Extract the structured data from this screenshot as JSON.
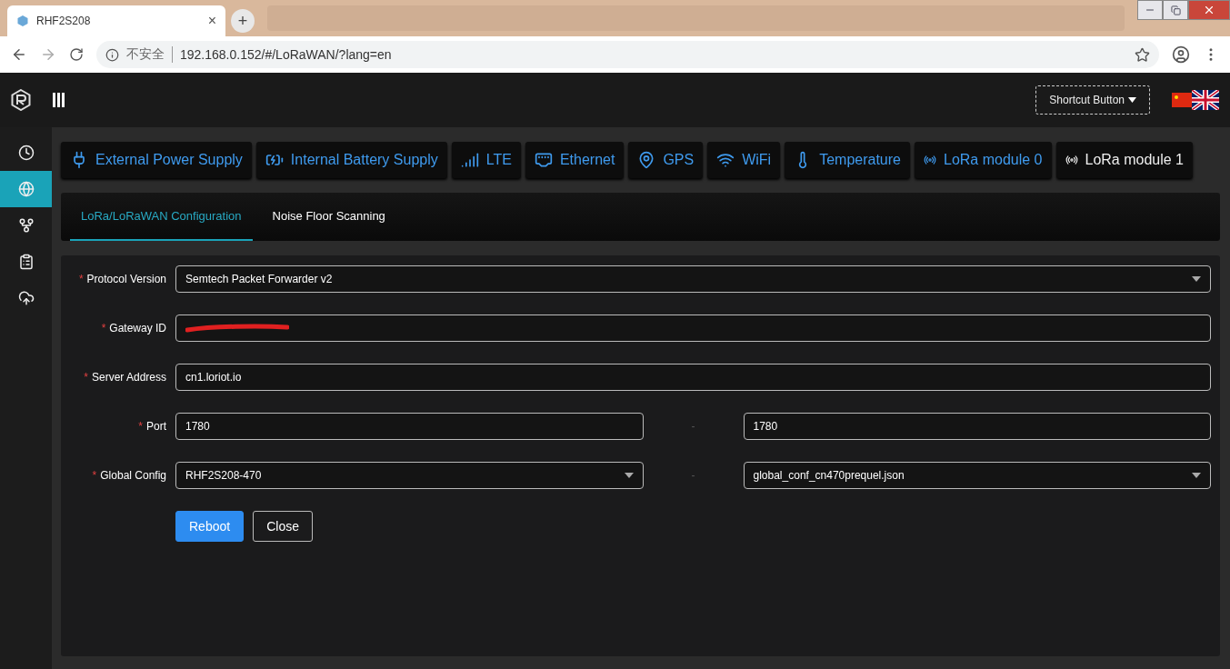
{
  "browser": {
    "tab_title": "RHF2S208",
    "close": "×",
    "new_tab": "+",
    "security": "不安全",
    "url": "192.168.0.152/#/LoRaWAN/?lang=en"
  },
  "header": {
    "shortcut_button": "Shortcut Button"
  },
  "sidebar": {
    "items": [
      {
        "selected": false
      },
      {
        "selected": true
      },
      {
        "selected": false
      },
      {
        "selected": false
      },
      {
        "selected": false
      }
    ]
  },
  "modules": [
    {
      "label": "External Power Supply",
      "selected": false
    },
    {
      "label": "Internal Battery Supply",
      "selected": false
    },
    {
      "label": "LTE",
      "selected": false
    },
    {
      "label": "Ethernet",
      "selected": false
    },
    {
      "label": "GPS",
      "selected": false
    },
    {
      "label": "WiFi",
      "selected": false
    },
    {
      "label": "Temperature",
      "selected": false
    },
    {
      "label": "LoRa module 0",
      "selected": false
    },
    {
      "label": "LoRa module 1",
      "selected": true
    }
  ],
  "tabs": [
    {
      "label": "LoRa/LoRaWAN Configuration",
      "selected": true
    },
    {
      "label": "Noise Floor Scanning",
      "selected": false
    }
  ],
  "form": {
    "rows": [
      {
        "label": "Protocol Version",
        "required_mark": "*",
        "fields": [
          {
            "kind": "select",
            "value": "Semtech Packet Forwarder v2"
          }
        ]
      },
      {
        "label": "Gateway ID",
        "required_mark": "*",
        "fields": [
          {
            "kind": "redacted"
          }
        ]
      },
      {
        "label": "Server Address",
        "required_mark": "*",
        "fields": [
          {
            "kind": "input",
            "value": "cn1.loriot.io"
          }
        ]
      },
      {
        "label": "Port",
        "required_mark": "*",
        "separator": "-",
        "fields": [
          {
            "kind": "input",
            "value": "1780"
          },
          {
            "kind": "input",
            "value": "1780"
          }
        ]
      },
      {
        "label": "Global Config",
        "required_mark": "*",
        "separator": "-",
        "fields": [
          {
            "kind": "select",
            "value": "RHF2S208-470"
          },
          {
            "kind": "select",
            "value": "global_conf_cn470prequel.json"
          }
        ]
      }
    ],
    "buttons": [
      {
        "label": "Reboot",
        "kind": "primary"
      },
      {
        "label": "Close",
        "kind": "default"
      }
    ]
  }
}
